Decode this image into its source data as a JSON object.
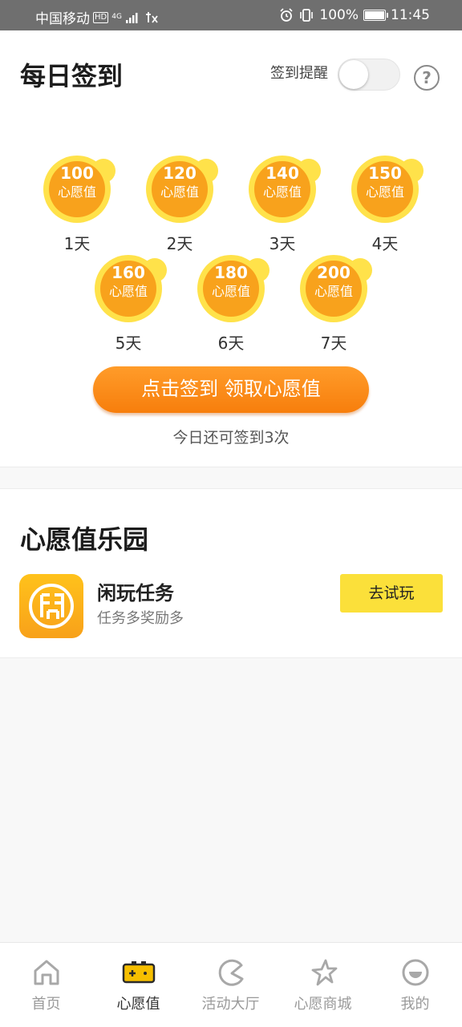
{
  "status_bar": {
    "carrier": "中国移动",
    "hd": "HD",
    "network": "4G",
    "battery": "100%",
    "time": "11:45"
  },
  "signin": {
    "title": "每日签到",
    "reminder_label": "签到提醒",
    "reminder_on": false,
    "help": "?",
    "days": [
      {
        "amount": "100",
        "unit": "心愿值",
        "label": "1天"
      },
      {
        "amount": "120",
        "unit": "心愿值",
        "label": "2天"
      },
      {
        "amount": "140",
        "unit": "心愿值",
        "label": "3天"
      },
      {
        "amount": "150",
        "unit": "心愿值",
        "label": "4天"
      },
      {
        "amount": "160",
        "unit": "心愿值",
        "label": "5天"
      },
      {
        "amount": "180",
        "unit": "心愿值",
        "label": "6天"
      },
      {
        "amount": "200",
        "unit": "心愿值",
        "label": "7天"
      }
    ],
    "button_label": "点击签到 领取心愿值",
    "remaining_text": "今日还可签到3次"
  },
  "park": {
    "title": "心愿值乐园",
    "task": {
      "name": "闲玩任务",
      "desc": "任务多奖励多",
      "button": "去试玩"
    }
  },
  "nav": {
    "items": [
      {
        "label": "首页",
        "icon": "home-icon"
      },
      {
        "label": "心愿值",
        "icon": "gamepad-icon",
        "active": true
      },
      {
        "label": "活动大厅",
        "icon": "pacman-icon"
      },
      {
        "label": "心愿商城",
        "icon": "star-icon"
      },
      {
        "label": "我的",
        "icon": "smiley-icon"
      }
    ]
  },
  "colors": {
    "accent_orange": "#f8a21c",
    "coin_ring": "#ffe24a",
    "button_yellow": "#fbe03a",
    "nav_active": "#f6bf00"
  }
}
